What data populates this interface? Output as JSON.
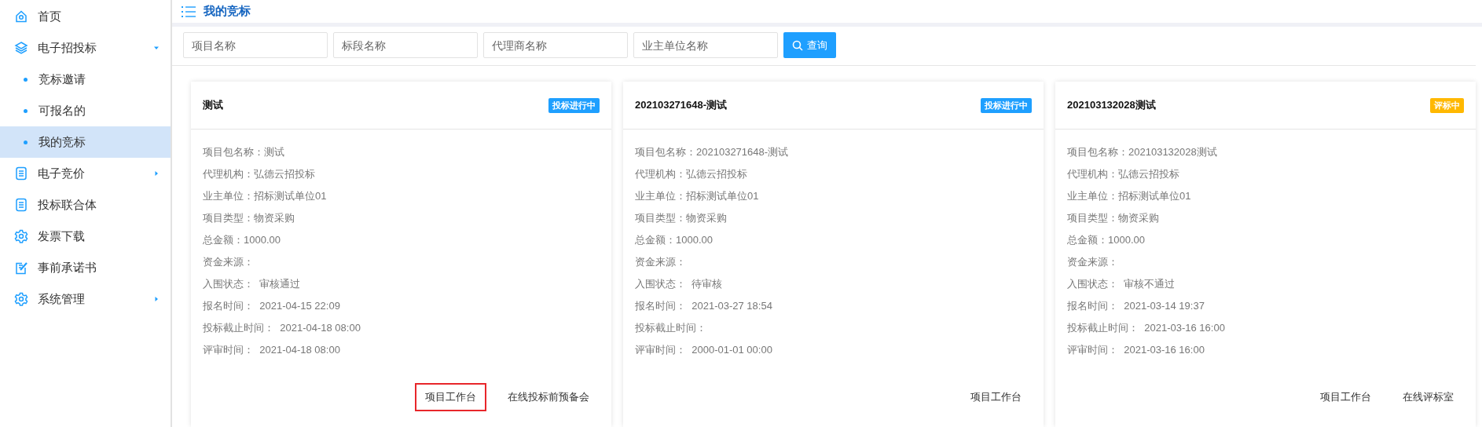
{
  "sidebar": {
    "items": [
      {
        "label": "首页",
        "selected": false
      },
      {
        "label": "电子招投标",
        "selected": false,
        "expanded": true,
        "children": [
          {
            "label": "竞标邀请",
            "selected": false
          },
          {
            "label": "可报名的",
            "selected": false
          },
          {
            "label": "我的竞标",
            "selected": true
          }
        ]
      },
      {
        "label": "电子竞价",
        "selected": false,
        "expanded": false
      },
      {
        "label": "投标联合体",
        "selected": false
      },
      {
        "label": "发票下载",
        "selected": false
      },
      {
        "label": "事前承诺书",
        "selected": false
      },
      {
        "label": "系统管理",
        "selected": false,
        "expanded": false
      }
    ]
  },
  "page_title": "我的竞标",
  "search": {
    "fields": [
      {
        "placeholder": "项目名称"
      },
      {
        "placeholder": "标段名称"
      },
      {
        "placeholder": "代理商名称"
      },
      {
        "placeholder": "业主单位名称"
      }
    ],
    "button": "查询"
  },
  "cards": [
    {
      "title": "测试",
      "status": {
        "text": "投标进行中",
        "color": "#1e9fff"
      },
      "fields": [
        "项目包名称：测试",
        "代理机构：弘德云招投标",
        "业主单位：招标测试单位01",
        "项目类型：物资采购",
        "总金额：1000.00",
        "资金来源：",
        "入围状态：  审核通过",
        "报名时间：  2021-04-15 22:09",
        "投标截止时间：  2021-04-18 08:00",
        "评审时间：  2021-04-18 08:00"
      ],
      "actions": [
        {
          "label": "项目工作台",
          "highlighted": true
        },
        {
          "label": "在线投标前预备会",
          "highlighted": false
        }
      ]
    },
    {
      "title": "202103271648-测试",
      "status": {
        "text": "投标进行中",
        "color": "#1e9fff"
      },
      "fields": [
        "项目包名称：202103271648-测试",
        "代理机构：弘德云招投标",
        "业主单位：招标测试单位01",
        "项目类型：物资采购",
        "总金额：1000.00",
        "资金来源：",
        "入围状态：  待审核",
        "报名时间：  2021-03-27 18:54",
        "投标截止时间：",
        "评审时间：  2000-01-01 00:00"
      ],
      "actions": [
        {
          "label": "项目工作台",
          "highlighted": false
        }
      ]
    },
    {
      "title": "202103132028测试",
      "status": {
        "text": "评标中",
        "color": "#ffb800"
      },
      "fields": [
        "项目包名称：202103132028测试",
        "代理机构：弘德云招投标",
        "业主单位：招标测试单位01",
        "项目类型：物资采购",
        "总金额：1000.00",
        "资金来源：",
        "入围状态：  审核不通过",
        "报名时间：  2021-03-14 19:37",
        "投标截止时间：  2021-03-16 16:00",
        "评审时间：  2021-03-16 16:00"
      ],
      "actions": [
        {
          "label": "项目工作台",
          "highlighted": false
        },
        {
          "label": "在线评标室",
          "highlighted": false
        }
      ]
    }
  ]
}
